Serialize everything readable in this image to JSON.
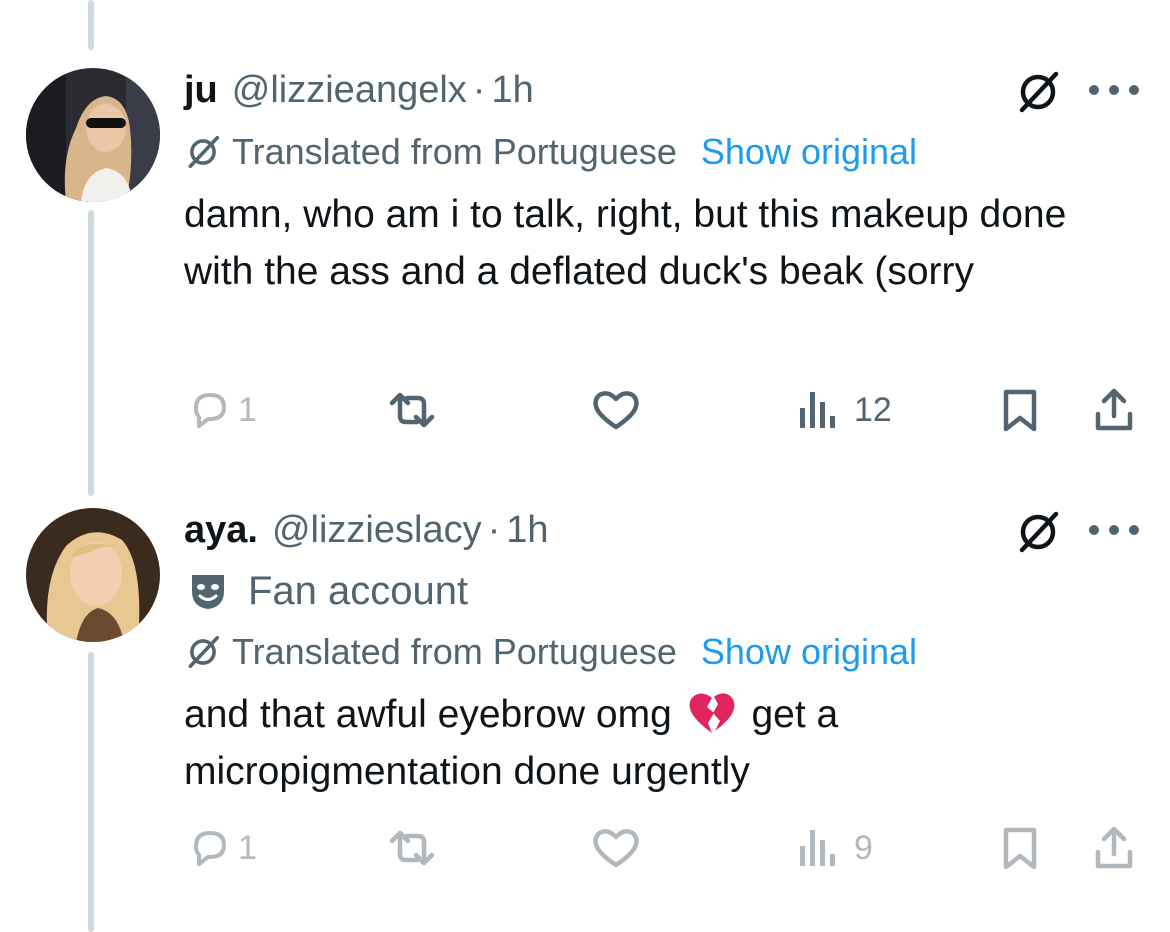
{
  "colors": {
    "text": "#0f1419",
    "secondary": "#536471",
    "link": "#1d9bf0",
    "thread_line": "#cfd9de",
    "broken_heart": "#e0245e"
  },
  "tweets": [
    {
      "display_name": "ju",
      "handle": "@lizzieangelx",
      "separator": "·",
      "time": "1h",
      "translated_label": "Translated from Portuguese",
      "show_original": "Show original",
      "text": "damn, who am i to talk, right, but this makeup done with the ass and a deflated duck's beak (sorry",
      "actions": {
        "reply_count": "1",
        "retweet_count": "",
        "like_count": "",
        "views_count": "12"
      },
      "icons": [
        "grok-icon",
        "more-icon",
        "translate-icon",
        "reply-icon",
        "retweet-icon",
        "like-icon",
        "views-icon",
        "bookmark-icon",
        "share-icon"
      ]
    },
    {
      "display_name": "aya.",
      "handle": "@lizzieslacy",
      "separator": "·",
      "time": "1h",
      "badge_label": "Fan account",
      "translated_label": "Translated from Portuguese",
      "show_original": "Show original",
      "text_part1": "and that awful eyebrow omg",
      "text_part2": " get a micropigmentation done urgently",
      "emoji": "broken-heart",
      "actions": {
        "reply_count": "1",
        "retweet_count": "",
        "like_count": "",
        "views_count": "9"
      },
      "icons": [
        "grok-icon",
        "more-icon",
        "mask-icon",
        "translate-icon",
        "reply-icon",
        "retweet-icon",
        "like-icon",
        "views-icon",
        "bookmark-icon",
        "share-icon"
      ]
    }
  ]
}
